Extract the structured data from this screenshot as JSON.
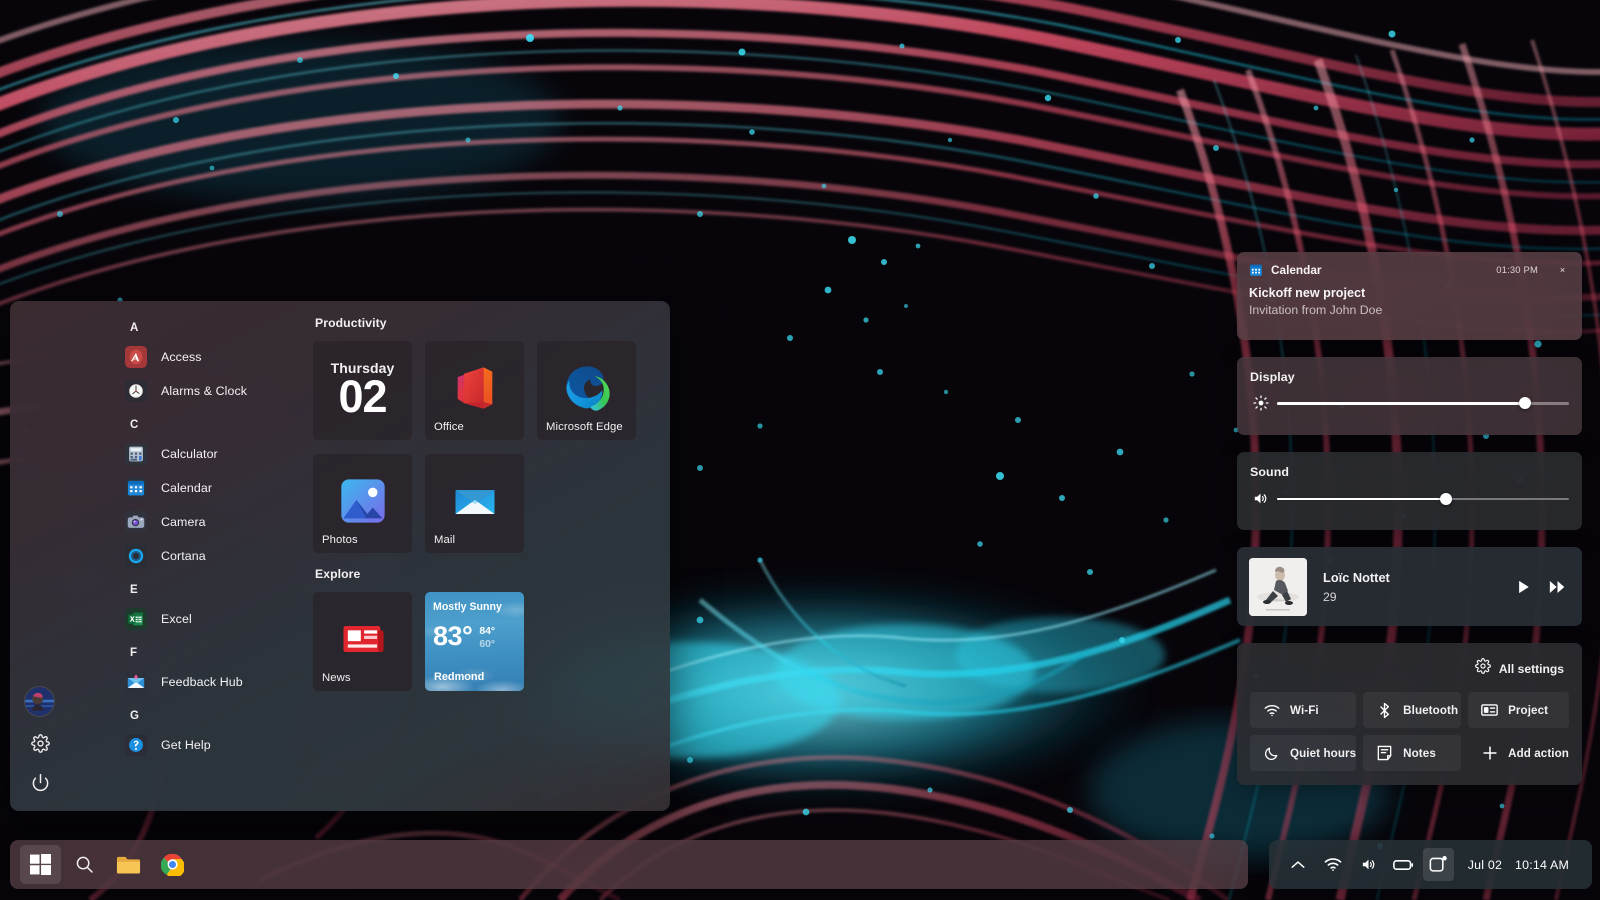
{
  "desktop": {
    "wallpaper_name": "abstract-fluid-art-wallpaper",
    "colors": {
      "pink": "#e8556f",
      "cyan": "#22d3ee",
      "black": "#07050a",
      "light_pink": "#f598a6"
    }
  },
  "start_menu": {
    "rail": [
      {
        "name": "user-avatar",
        "icon": "avatar-icon",
        "label": "User account"
      },
      {
        "name": "settings",
        "icon": "gear-icon",
        "label": "Settings"
      },
      {
        "name": "power",
        "icon": "power-icon",
        "label": "Power"
      }
    ],
    "app_list": [
      {
        "type": "header",
        "label": "A"
      },
      {
        "type": "app",
        "label": "Access",
        "icon": "access-icon"
      },
      {
        "type": "app",
        "label": "Alarms & Clock",
        "icon": "clock-icon"
      },
      {
        "type": "header",
        "label": "C"
      },
      {
        "type": "app",
        "label": "Calculator",
        "icon": "calculator-icon"
      },
      {
        "type": "app",
        "label": "Calendar",
        "icon": "calendar-icon"
      },
      {
        "type": "app",
        "label": "Camera",
        "icon": "camera-icon"
      },
      {
        "type": "app",
        "label": "Cortana",
        "icon": "cortana-icon"
      },
      {
        "type": "header",
        "label": "E"
      },
      {
        "type": "app",
        "label": "Excel",
        "icon": "excel-icon"
      },
      {
        "type": "header",
        "label": "F"
      },
      {
        "type": "app",
        "label": "Feedback Hub",
        "icon": "feedback-hub-icon"
      },
      {
        "type": "header",
        "label": "G"
      },
      {
        "type": "app",
        "label": "Get Help",
        "icon": "get-help-icon"
      }
    ],
    "tile_groups": [
      {
        "title": "Productivity",
        "rows": [
          [
            {
              "kind": "calendar",
              "name": "Calendar",
              "day": "Thursday",
              "date": "02"
            },
            {
              "kind": "app",
              "name": "Office",
              "icon": "office-icon"
            },
            {
              "kind": "app",
              "name": "Microsoft Edge",
              "icon": "edge-icon"
            }
          ],
          [
            {
              "kind": "app",
              "name": "Photos",
              "icon": "photos-icon"
            },
            {
              "kind": "app",
              "name": "Mail",
              "icon": "mail-icon"
            }
          ]
        ]
      },
      {
        "title": "Explore",
        "rows": [
          [
            {
              "kind": "app",
              "name": "News",
              "icon": "news-icon"
            },
            {
              "kind": "weather",
              "name": "Weather",
              "condition": "Mostly Sunny",
              "temp": "83°",
              "high": "84°",
              "low": "60°",
              "city": "Redmond"
            }
          ]
        ]
      }
    ]
  },
  "action_center": {
    "notification": {
      "app": "Calendar",
      "app_icon": "calendar-icon",
      "time": "01:30 PM",
      "title": "Kickoff new project",
      "subtitle": "Invitation from John Doe",
      "close_glyph": "×"
    },
    "display": {
      "label": "Display",
      "icon": "brightness-icon",
      "value": 85
    },
    "sound": {
      "label": "Sound",
      "icon": "volume-icon",
      "value": 58
    },
    "media": {
      "artist": "Loïc Nottet",
      "track": "29",
      "album_art": "album-art-icon",
      "controls": [
        {
          "name": "play-button",
          "icon": "play-icon"
        },
        {
          "name": "next-button",
          "icon": "next-track-icon"
        }
      ]
    },
    "all_settings": {
      "label": "All settings",
      "icon": "gear-icon"
    },
    "quick_actions": [
      {
        "label": "Wi-Fi",
        "icon": "wifi-icon",
        "filled": true
      },
      {
        "label": "Bluetooth",
        "icon": "bluetooth-icon",
        "filled": true
      },
      {
        "label": "Project",
        "icon": "project-icon",
        "filled": true
      },
      {
        "label": "Quiet hours",
        "icon": "moon-icon",
        "filled": true
      },
      {
        "label": "Notes",
        "icon": "notes-icon",
        "filled": true
      },
      {
        "label": "Add action",
        "icon": "plus-icon",
        "filled": false
      }
    ]
  },
  "taskbar": {
    "left_items": [
      {
        "name": "start-button",
        "icon": "windows-logo-icon",
        "active": true
      },
      {
        "name": "search-button",
        "icon": "search-icon",
        "active": false
      },
      {
        "name": "file-explorer-button",
        "icon": "folder-icon",
        "active": false
      },
      {
        "name": "chrome-button",
        "icon": "chrome-icon",
        "active": false
      }
    ],
    "tray": [
      {
        "name": "show-hidden-icons",
        "icon": "chevron-up-icon"
      },
      {
        "name": "network",
        "icon": "wifi-icon"
      },
      {
        "name": "volume",
        "icon": "volume-icon"
      },
      {
        "name": "battery",
        "icon": "battery-icon"
      },
      {
        "name": "action-center",
        "icon": "action-center-icon",
        "active": true
      }
    ],
    "clock": {
      "date": "Jul 02",
      "time": "10:14 AM"
    }
  }
}
